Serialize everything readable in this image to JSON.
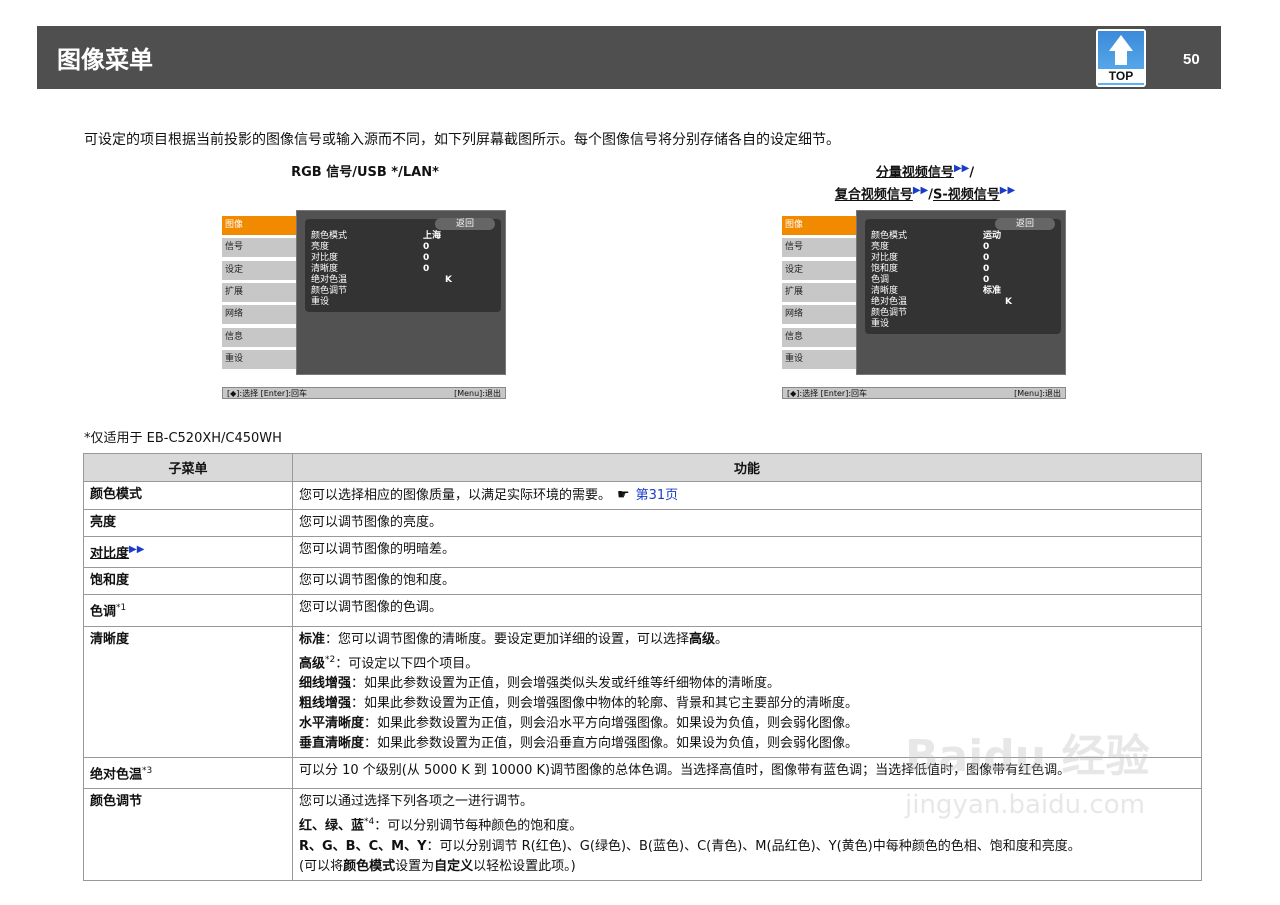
{
  "header": {
    "title": "图像菜单",
    "top_label": "TOP",
    "page_number": "50"
  },
  "intro": "可设定的项目根据当前投影的图像信号或输入源而不同，如下列屏幕截图所示。每个图像信号将分别存储各自的设定细节。",
  "left_caption": "RGB 信号/USB */LAN*",
  "right_caption": {
    "line1_part1": "分量视频信号",
    "line1_sep": "/",
    "line2_part1": "复合视频信号",
    "line2_sep": "/",
    "line2_part2": "S-视频信号"
  },
  "menu_items": [
    "图像",
    "信号",
    "设定",
    "扩展",
    "网络",
    "信息",
    "重设"
  ],
  "menu_back": "返回",
  "menu_footer": {
    "left": "[◆]:选择 [Enter]:回车",
    "right": "[Menu]:退出"
  },
  "left_menu_rows": [
    {
      "label": "颜色模式",
      "value": "上海"
    },
    {
      "label": "亮度",
      "value": "0"
    },
    {
      "label": "对比度",
      "value": "0"
    },
    {
      "label": "清晰度",
      "value": "0"
    },
    {
      "label": "绝对色温",
      "value": "K"
    },
    {
      "label": "颜色调节",
      "value": ""
    },
    {
      "label": "重设",
      "value": ""
    }
  ],
  "right_menu_rows": [
    {
      "label": "颜色模式",
      "value": "运动"
    },
    {
      "label": "亮度",
      "value": "0"
    },
    {
      "label": "对比度",
      "value": "0"
    },
    {
      "label": "饱和度",
      "value": "0"
    },
    {
      "label": "色调",
      "value": "0"
    },
    {
      "label": "清晰度",
      "value": "标准"
    },
    {
      "label": "绝对色温",
      "value": "K"
    },
    {
      "label": "颜色调节",
      "value": ""
    },
    {
      "label": "重设",
      "value": ""
    }
  ],
  "note": "*仅适用于  EB-C520XH/C450WH",
  "table": {
    "col_submenu": "子菜单",
    "col_function": "功能",
    "r1": {
      "k": "颜色模式",
      "v": "您可以选择相应的图像质量，以满足实际环境的需要。",
      "link": "第31页"
    },
    "r2": {
      "k": "亮度",
      "v": "您可以调节图像的亮度。"
    },
    "r3": {
      "k": "对比度",
      "v": "您可以调节图像的明暗差。"
    },
    "r4": {
      "k": "饱和度",
      "v": "您可以调节图像的饱和度。"
    },
    "r5": {
      "k": "色调",
      "sup": "*1",
      "v": "您可以调节图像的色调。"
    },
    "r6": {
      "k": "清晰度",
      "l1b": "标准",
      "l1": "：您可以调节图像的清晰度。要设定更加详细的设置，可以选择",
      "l1b2": "高级",
      "l1e": "。",
      "l2b": "高级",
      "l2sup": "*2",
      "l2": "：可设定以下四个项目。",
      "l3b": "细线增强",
      "l3": "：如果此参数设置为正值，则会增强类似头发或纤维等纤细物体的清晰度。",
      "l4b": "粗线增强",
      "l4": "：如果此参数设置为正值，则会增强图像中物体的轮廓、背景和其它主要部分的清晰度。",
      "l5b": "水平清晰度",
      "l5": "：如果此参数设置为正值，则会沿水平方向增强图像。如果设为负值，则会弱化图像。",
      "l6b": "垂直清晰度",
      "l6": "：如果此参数设置为正值，则会沿垂直方向增强图像。如果设为负值，则会弱化图像。"
    },
    "r7": {
      "k": "绝对色温",
      "sup": "*3",
      "v": "可以分  10  个级别(从  5000  K  到  10000  K)调节图像的总体色调。当选择高值时，图像带有蓝色调；当选择低值时，图像带有红色调。"
    },
    "r8": {
      "k": "颜色调节",
      "l1": "您可以通过选择下列各项之一进行调节。",
      "l2b": "红、绿、蓝",
      "l2sup": "*4",
      "l2": "：可以分别调节每种颜色的饱和度。",
      "l3b": "R、G、B、C、M、Y",
      "l3": "：可以分别调节  R(红色)、G(绿色)、B(蓝色)、C(青色)、M(品红色)、Y(黄色)中每种颜色的色相、饱和度和亮度。",
      "l4a": "(可以将",
      "l4b": "颜色模式",
      "l4c": "设置为",
      "l4d": "自定义",
      "l4e": "以轻松设置此项。)"
    }
  },
  "watermark": {
    "line1": "Baidu 经验",
    "line2": "jingyan.baidu.com"
  }
}
